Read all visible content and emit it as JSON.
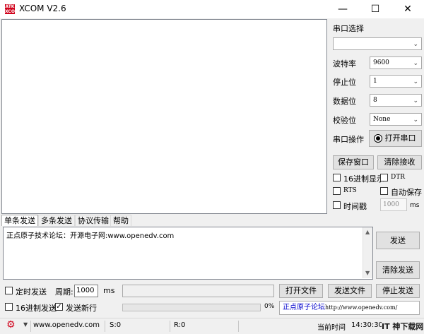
{
  "app": {
    "logo_text": "ATK XCOM",
    "title": "XCOM V2.6"
  },
  "window_controls": {
    "minimize": "—",
    "maximize": "☐",
    "close": "✕"
  },
  "port_panel": {
    "port_select_label": "串口选择",
    "port_value": "",
    "baud_label": "波特率",
    "baud_value": "9600",
    "stop_label": "停止位",
    "stop_value": "1",
    "data_label": "数据位",
    "data_value": "8",
    "parity_label": "校验位",
    "parity_value": "None",
    "operation_label": "串口操作",
    "open_port_button": "打开串口",
    "save_window_button": "保存窗口",
    "clear_receive_button": "清除接收",
    "hex_display_label": "16进制显示",
    "dtr_label": "DTR",
    "rts_label": "RTS",
    "auto_save_label": "自动保存",
    "timestamp_label": "时间戳",
    "timestamp_value": "1000",
    "timestamp_unit": "ms"
  },
  "tabs": [
    "单条发送",
    "多条发送",
    "协议传输",
    "帮助"
  ],
  "send_area": {
    "text": "正点原子技术论坛：开源电子网:www.openedv.com",
    "send_button": "发送",
    "clear_send_button": "清除发送"
  },
  "bottom_controls": {
    "timed_send_label": "定时发送",
    "period_label": "周期:",
    "period_value": "1000",
    "period_unit": "ms",
    "open_file_button": "打开文件",
    "send_file_button": "发送文件",
    "stop_send_button": "停止发送",
    "hex_send_label": "16进制发送",
    "send_newline_label": "发送新行",
    "progress_percent": "0%",
    "forum_link_text": "正点原子论坛",
    "forum_url": "http://www.openedv.com/"
  },
  "status_bar": {
    "website": "www.openedv.com",
    "sent": "S:0",
    "received": "R:0",
    "current_time_label": "当前时间",
    "current_time": "14:30:30",
    "watermark": "IT 神下载网"
  },
  "colors": {
    "accent_red": "#d0021b",
    "link_blue": "#0000cc"
  }
}
